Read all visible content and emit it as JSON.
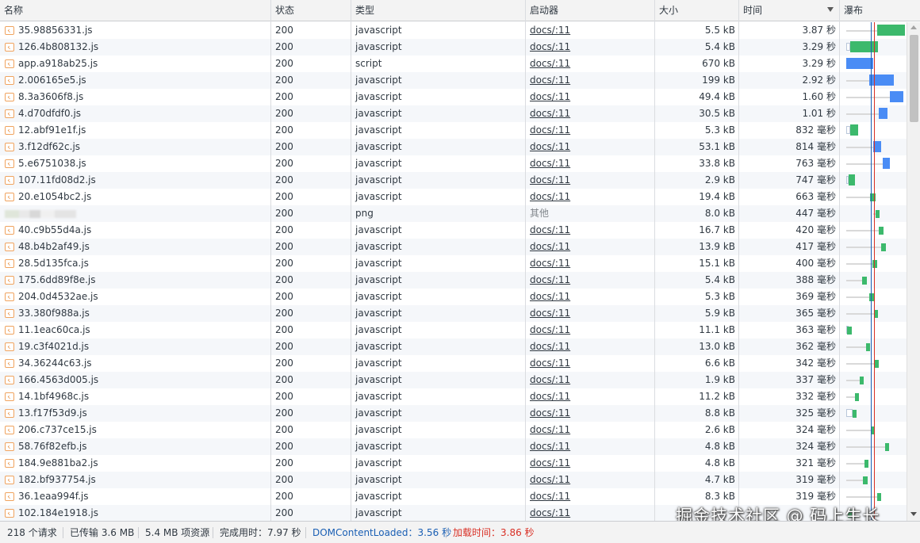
{
  "columns": {
    "name": "名称",
    "status": "状态",
    "type": "类型",
    "initiator": "启动器",
    "size": "大小",
    "time": "时间",
    "waterfall": "瀑布"
  },
  "rows": [
    {
      "name": "35.98856331.js",
      "status": "200",
      "type": "javascript",
      "initiator": "docs/:11",
      "size": "5.5 kB",
      "time": "3.87 秒"
    },
    {
      "name": "126.4b808132.js",
      "status": "200",
      "type": "javascript",
      "initiator": "docs/:11",
      "size": "5.4 kB",
      "time": "3.29 秒"
    },
    {
      "name": "app.a918ab25.js",
      "status": "200",
      "type": "script",
      "initiator": "docs/:11",
      "size": "670 kB",
      "time": "3.29 秒"
    },
    {
      "name": "2.006165e5.js",
      "status": "200",
      "type": "javascript",
      "initiator": "docs/:11",
      "size": "199 kB",
      "time": "2.92 秒"
    },
    {
      "name": "8.3a3606f8.js",
      "status": "200",
      "type": "javascript",
      "initiator": "docs/:11",
      "size": "49.4 kB",
      "time": "1.60 秒"
    },
    {
      "name": "4.d70dfdf0.js",
      "status": "200",
      "type": "javascript",
      "initiator": "docs/:11",
      "size": "30.5 kB",
      "time": "1.01 秒"
    },
    {
      "name": "12.abf91e1f.js",
      "status": "200",
      "type": "javascript",
      "initiator": "docs/:11",
      "size": "5.3 kB",
      "time": "832 毫秒"
    },
    {
      "name": "3.f12df62c.js",
      "status": "200",
      "type": "javascript",
      "initiator": "docs/:11",
      "size": "53.1 kB",
      "time": "814 毫秒"
    },
    {
      "name": "5.e6751038.js",
      "status": "200",
      "type": "javascript",
      "initiator": "docs/:11",
      "size": "33.8 kB",
      "time": "763 毫秒"
    },
    {
      "name": "107.11fd08d2.js",
      "status": "200",
      "type": "javascript",
      "initiator": "docs/:11",
      "size": "2.9 kB",
      "time": "747 毫秒"
    },
    {
      "name": "20.e1054bc2.js",
      "status": "200",
      "type": "javascript",
      "initiator": "docs/:11",
      "size": "19.4 kB",
      "time": "663 毫秒"
    },
    {
      "name": "",
      "status": "200",
      "type": "png",
      "initiator": "其他",
      "size": "8.0 kB",
      "time": "447 毫秒"
    },
    {
      "name": "40.c9b55d4a.js",
      "status": "200",
      "type": "javascript",
      "initiator": "docs/:11",
      "size": "16.7 kB",
      "time": "420 毫秒"
    },
    {
      "name": "48.b4b2af49.js",
      "status": "200",
      "type": "javascript",
      "initiator": "docs/:11",
      "size": "13.9 kB",
      "time": "417 毫秒"
    },
    {
      "name": "28.5d135fca.js",
      "status": "200",
      "type": "javascript",
      "initiator": "docs/:11",
      "size": "15.1 kB",
      "time": "400 毫秒"
    },
    {
      "name": "175.6dd89f8e.js",
      "status": "200",
      "type": "javascript",
      "initiator": "docs/:11",
      "size": "5.4 kB",
      "time": "388 毫秒"
    },
    {
      "name": "204.0d4532ae.js",
      "status": "200",
      "type": "javascript",
      "initiator": "docs/:11",
      "size": "5.3 kB",
      "time": "369 毫秒"
    },
    {
      "name": "33.380f988a.js",
      "status": "200",
      "type": "javascript",
      "initiator": "docs/:11",
      "size": "5.9 kB",
      "time": "365 毫秒"
    },
    {
      "name": "11.1eac60ca.js",
      "status": "200",
      "type": "javascript",
      "initiator": "docs/:11",
      "size": "11.1 kB",
      "time": "363 毫秒"
    },
    {
      "name": "19.c3f4021d.js",
      "status": "200",
      "type": "javascript",
      "initiator": "docs/:11",
      "size": "13.0 kB",
      "time": "362 毫秒"
    },
    {
      "name": "34.36244c63.js",
      "status": "200",
      "type": "javascript",
      "initiator": "docs/:11",
      "size": "6.6 kB",
      "time": "342 毫秒"
    },
    {
      "name": "166.4563d005.js",
      "status": "200",
      "type": "javascript",
      "initiator": "docs/:11",
      "size": "1.9 kB",
      "time": "337 毫秒"
    },
    {
      "name": "14.1bf4968c.js",
      "status": "200",
      "type": "javascript",
      "initiator": "docs/:11",
      "size": "11.2 kB",
      "time": "332 毫秒"
    },
    {
      "name": "13.f17f53d9.js",
      "status": "200",
      "type": "javascript",
      "initiator": "docs/:11",
      "size": "8.8 kB",
      "time": "325 毫秒"
    },
    {
      "name": "206.c737ce15.js",
      "status": "200",
      "type": "javascript",
      "initiator": "docs/:11",
      "size": "2.6 kB",
      "time": "324 毫秒"
    },
    {
      "name": "58.76f82efb.js",
      "status": "200",
      "type": "javascript",
      "initiator": "docs/:11",
      "size": "4.8 kB",
      "time": "324 毫秒"
    },
    {
      "name": "184.9e881ba2.js",
      "status": "200",
      "type": "javascript",
      "initiator": "docs/:11",
      "size": "4.8 kB",
      "time": "321 毫秒"
    },
    {
      "name": "182.bf937754.js",
      "status": "200",
      "type": "javascript",
      "initiator": "docs/:11",
      "size": "4.7 kB",
      "time": "319 毫秒"
    },
    {
      "name": "36.1eaa994f.js",
      "status": "200",
      "type": "javascript",
      "initiator": "docs/:11",
      "size": "8.3 kB",
      "time": "319 毫秒"
    },
    {
      "name": "102.184e1918.js",
      "status": "200",
      "type": "javascript",
      "initiator": "docs/:11",
      "size": "",
      "time": ""
    }
  ],
  "status_bar": {
    "requests": "218 个请求",
    "transferred": "已传输 3.6 MB",
    "resources": "5.4 MB 项资源",
    "finish": "完成用时：7.97 秒",
    "dcl": "DOMContentLoaded：3.56 秒",
    "load": "加载时间：3.86 秒"
  },
  "watermark": "掘金技术社区 @ 码上生长",
  "colors": {
    "waterfall_green": "#3cb96c",
    "waterfall_blue": "#4a8cf5",
    "dcl_marker": "#1a5fb4",
    "load_marker": "#d93025"
  }
}
